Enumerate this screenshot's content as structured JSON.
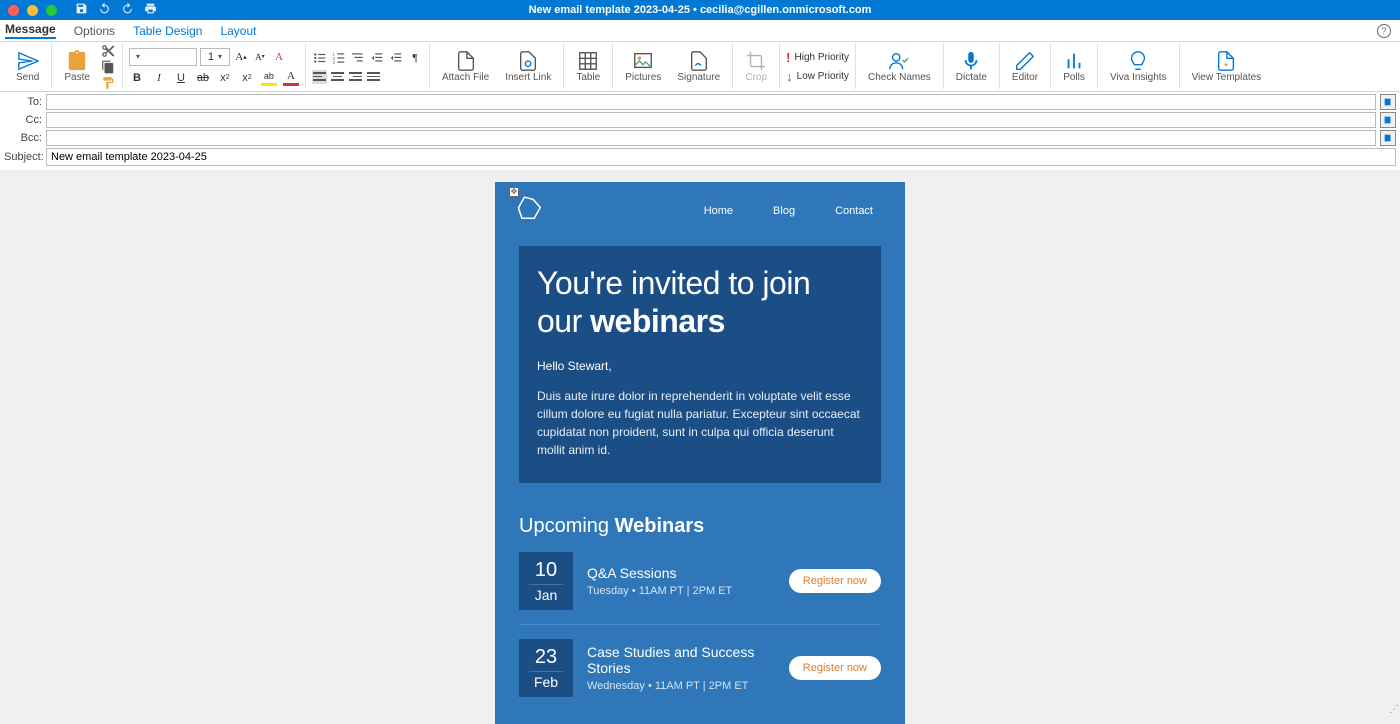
{
  "titlebar": {
    "close_color": "#ff5f57",
    "min_color": "#febc2e",
    "max_color": "#28c840",
    "title": "New email template 2023-04-25 • cecilia@cgillen.onmicrosoft.com"
  },
  "tabs": {
    "message": "Message",
    "options": "Options",
    "table_design": "Table Design",
    "layout": "Layout"
  },
  "ribbon": {
    "send": "Send",
    "paste": "Paste",
    "font_size": "1",
    "attach_file": "Attach File",
    "insert_link": "Insert Link",
    "table": "Table",
    "pictures": "Pictures",
    "signature": "Signature",
    "crop": "Crop",
    "high_priority": "High Priority",
    "low_priority": "Low Priority",
    "check_names": "Check Names",
    "dictate": "Dictate",
    "editor": "Editor",
    "polls": "Polls",
    "viva_insights": "Viva Insights",
    "view_templates": "View Templates"
  },
  "fields": {
    "to_label": "To:",
    "cc_label": "Cc:",
    "bcc_label": "Bcc:",
    "subject_label": "Subject:",
    "subject_value": "New email template 2023-04-25"
  },
  "email": {
    "nav": {
      "home": "Home",
      "blog": "Blog",
      "contact": "Contact"
    },
    "hero_title_pre": "You're invited to join our ",
    "hero_title_bold": "webinars",
    "greeting": "Hello Stewart,",
    "body": "Duis aute irure dolor in reprehenderit in voluptate velit esse cillum dolore eu fugiat nulla pariatur. Excepteur sint occaecat cupidatat non proident, sunt in culpa qui officia deserunt mollit anim id.",
    "upcoming_pre": "Upcoming ",
    "upcoming_bold": "Webinars",
    "webinars": [
      {
        "day": "10",
        "month": "Jan",
        "title": "Q&A Sessions",
        "sub": "Tuesday • 11AM PT | 2PM ET",
        "cta": "Register now"
      },
      {
        "day": "23",
        "month": "Feb",
        "title": "Case Studies and Success Stories",
        "sub": "Wednesday • 11AM PT | 2PM ET",
        "cta": "Register now"
      }
    ]
  }
}
